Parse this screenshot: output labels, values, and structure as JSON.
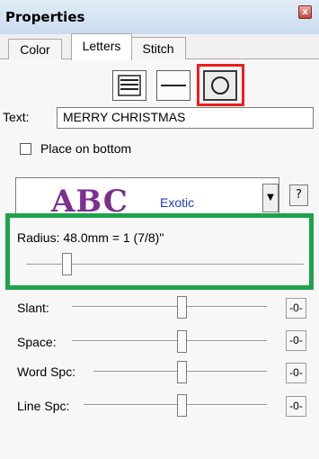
{
  "window": {
    "title": "Properties",
    "close_glyph": "x"
  },
  "tabs": [
    {
      "label": "Color",
      "active": false
    },
    {
      "label": "Letters",
      "active": true
    },
    {
      "label": "Stitch",
      "active": false
    }
  ],
  "shape_buttons": [
    {
      "icon": "lines-icon",
      "pressed": false
    },
    {
      "icon": "line-icon",
      "pressed": false
    },
    {
      "icon": "circle-icon",
      "pressed": true
    }
  ],
  "text_field": {
    "label": "Text:",
    "value": "MERRY CHRISTMAS"
  },
  "place_on_bottom": {
    "label": "Place on bottom",
    "checked": false
  },
  "font_selector": {
    "preview": "ABC",
    "name": "Exotic",
    "dropdown_glyph": "▼",
    "help_label": "?",
    "preview_color": "#7b2f8e",
    "name_color": "#1a3ec7"
  },
  "radius": {
    "label": "Radius: 48.0mm = 1 (7/8)\"",
    "slider_fraction": 0.18
  },
  "adjusters": [
    {
      "label": "Slant:",
      "reset_label": "-0-",
      "slider_fraction": 0.5
    },
    {
      "label": "Space:",
      "reset_label": "-0-",
      "slider_fraction": 0.5
    },
    {
      "label": "Word Spc:",
      "reset_label": "-0-",
      "slider_fraction": 0.5
    },
    {
      "label": "Line Spc:",
      "reset_label": "-0-",
      "slider_fraction": 0.5
    }
  ],
  "highlight_colors": {
    "red": "#ee1c1c",
    "green": "#1ea34a"
  }
}
